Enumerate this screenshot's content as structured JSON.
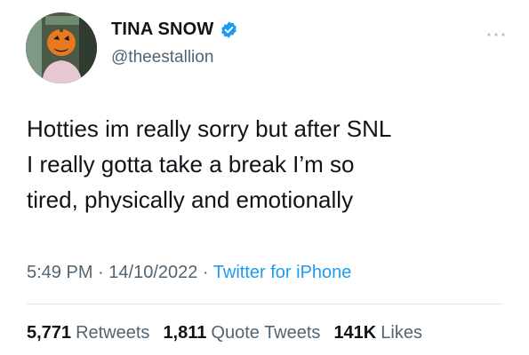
{
  "author": {
    "display_name": "TINA SNOW",
    "handle": "@theestallion",
    "verified_icon": "verified-badge-icon",
    "avatar_icon": "avatar"
  },
  "tweet": {
    "text": "Hotties im really sorry but after SNL\nI really gotta take a break I’m so\ntired, physically and emotionally"
  },
  "meta": {
    "time": "5:49 PM",
    "separator_1": " · ",
    "date": "14/10/2022",
    "separator_2": " · ",
    "source": "Twitter for iPhone"
  },
  "stats": {
    "retweets_count": "5,771",
    "retweets_label": "Retweets",
    "quotes_count": "1,811",
    "quotes_label": "Quote Tweets",
    "likes_count": "141K",
    "likes_label": "Likes"
  },
  "colors": {
    "text": "#0f1419",
    "secondary": "#536471",
    "link": "#1d9bf0",
    "divider": "#dfe4e8"
  }
}
